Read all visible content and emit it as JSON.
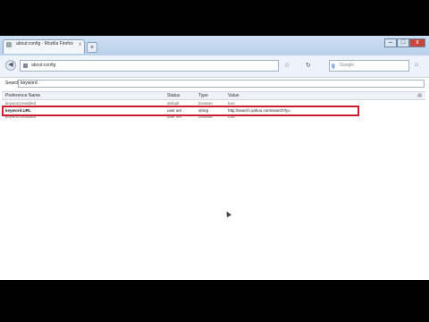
{
  "window": {
    "tab_title": "about:config - Mozilla Firefox",
    "new_tab": "+",
    "min": "–",
    "max": "□",
    "close": "x"
  },
  "navbar": {
    "back": "◀",
    "url": "about:config",
    "star": "☆",
    "reload": "↻",
    "search_placeholder": "Google",
    "search_engine": "g",
    "home": "⌂",
    "search_icon": "⚲"
  },
  "filter": {
    "label": "Search:",
    "value": "keyword"
  },
  "table": {
    "headers": [
      "Preference Name",
      "Status",
      "Type",
      "Value"
    ],
    "rows": [
      {
        "name": "keyword.enabled",
        "status": "default",
        "type": "boolean",
        "value": "true"
      },
      {
        "name": "keyword.URL",
        "status": "user set",
        "type": "string",
        "value": "http://search.yahoo.com/search?p="
      },
      {
        "name": "keyword.enabled",
        "status": "user set",
        "type": "boolean",
        "value": "true"
      }
    ]
  },
  "colors": {
    "highlight": "#cc1f2d",
    "background": "#000000"
  }
}
